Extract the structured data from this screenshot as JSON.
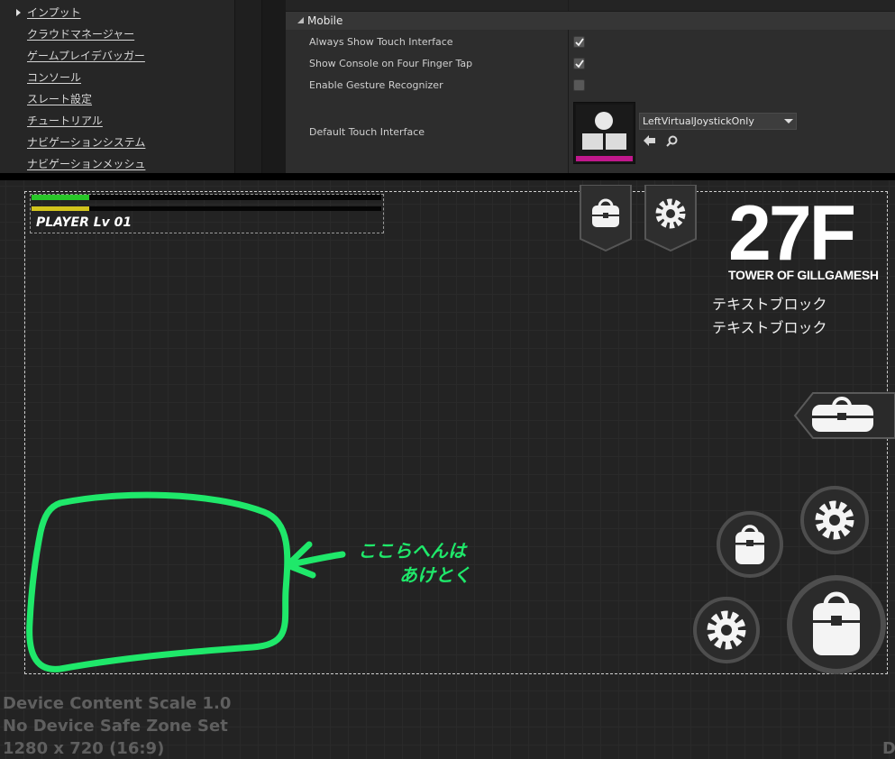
{
  "sidebar": {
    "items": [
      {
        "label": "インプット",
        "expandable": true
      },
      {
        "label": "クラウドマネージャー"
      },
      {
        "label": "ゲームプレイデバッガー"
      },
      {
        "label": "コンソール"
      },
      {
        "label": "スレート設定"
      },
      {
        "label": "チュートリアル"
      },
      {
        "label": "ナビゲーションシステム"
      },
      {
        "label": "ナビゲーションメッシュ"
      }
    ]
  },
  "details": {
    "section_title": "Mobile",
    "properties": [
      {
        "label": "Always Show Touch Interface",
        "checked": true
      },
      {
        "label": "Show Console on Four Finger Tap",
        "checked": true
      },
      {
        "label": "Enable Gesture Recognizer",
        "checked": false
      }
    ],
    "default_touch": {
      "label": "Default Touch Interface",
      "value": "LeftVirtualJoystickOnly"
    }
  },
  "hud": {
    "player_label": "PLAYER  Lv 01",
    "hp_fraction": 0.165,
    "exp_fraction": 0.165,
    "floor": "27F",
    "tower": "TOWER OF GILLGAMESH",
    "text_block_1": "テキストブロック",
    "text_block_2": "テキストブロック"
  },
  "annotation": {
    "line1": "ここらへんは",
    "line2": "あけとく",
    "color": "#1fe86a"
  },
  "canvas_info": {
    "scale": "Device Content Scale 1.0",
    "safe_zone": "No Device Safe Zone Set",
    "resolution": "1280 x 720 (16:9)",
    "edge": "D"
  },
  "icons": [
    "backpack-icon",
    "gear-icon",
    "arrow-left-icon",
    "search-icon",
    "dropdown-arrow-icon"
  ],
  "colors": {
    "accent_green": "#1fe86a",
    "hp": "#28c628",
    "exp": "#d2c41c",
    "touch_thumb_accent": "#c0188c"
  }
}
